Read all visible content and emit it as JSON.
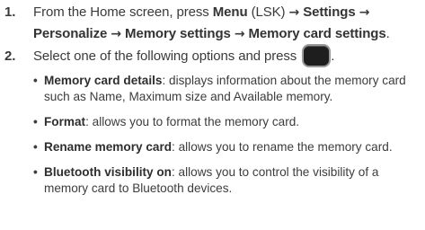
{
  "steps": [
    {
      "number": "1.",
      "parts": {
        "pre": "From the Home screen, press ",
        "menu": "Menu",
        "lsk": " (LSK) ",
        "arrow1": "→",
        "settings": " Settings ",
        "arrow2": "→",
        "personalize": "Personalize ",
        "arrow3": "→",
        "memory_settings": " Memory settings ",
        "arrow4": "→",
        "memory_card_settings": " Memory card settings",
        "end": "."
      }
    },
    {
      "number": "2.",
      "text": "Select one of the following options and press",
      "end": ".",
      "key_icon": "ok-key-icon"
    }
  ],
  "options": [
    {
      "term": "Memory card details",
      "desc": ": displays information about the memory card such as Name, Maximum size and Available memory."
    },
    {
      "term": "Format",
      "desc": ": allows you to format the memory card."
    },
    {
      "term": "Rename memory card",
      "desc": ": allows you to rename the memory card."
    },
    {
      "term": "Bluetooth visibility on",
      "desc": ": allows you to control the visibility of a memory card to Bluetooth devices."
    }
  ],
  "bullet_glyph": "•"
}
